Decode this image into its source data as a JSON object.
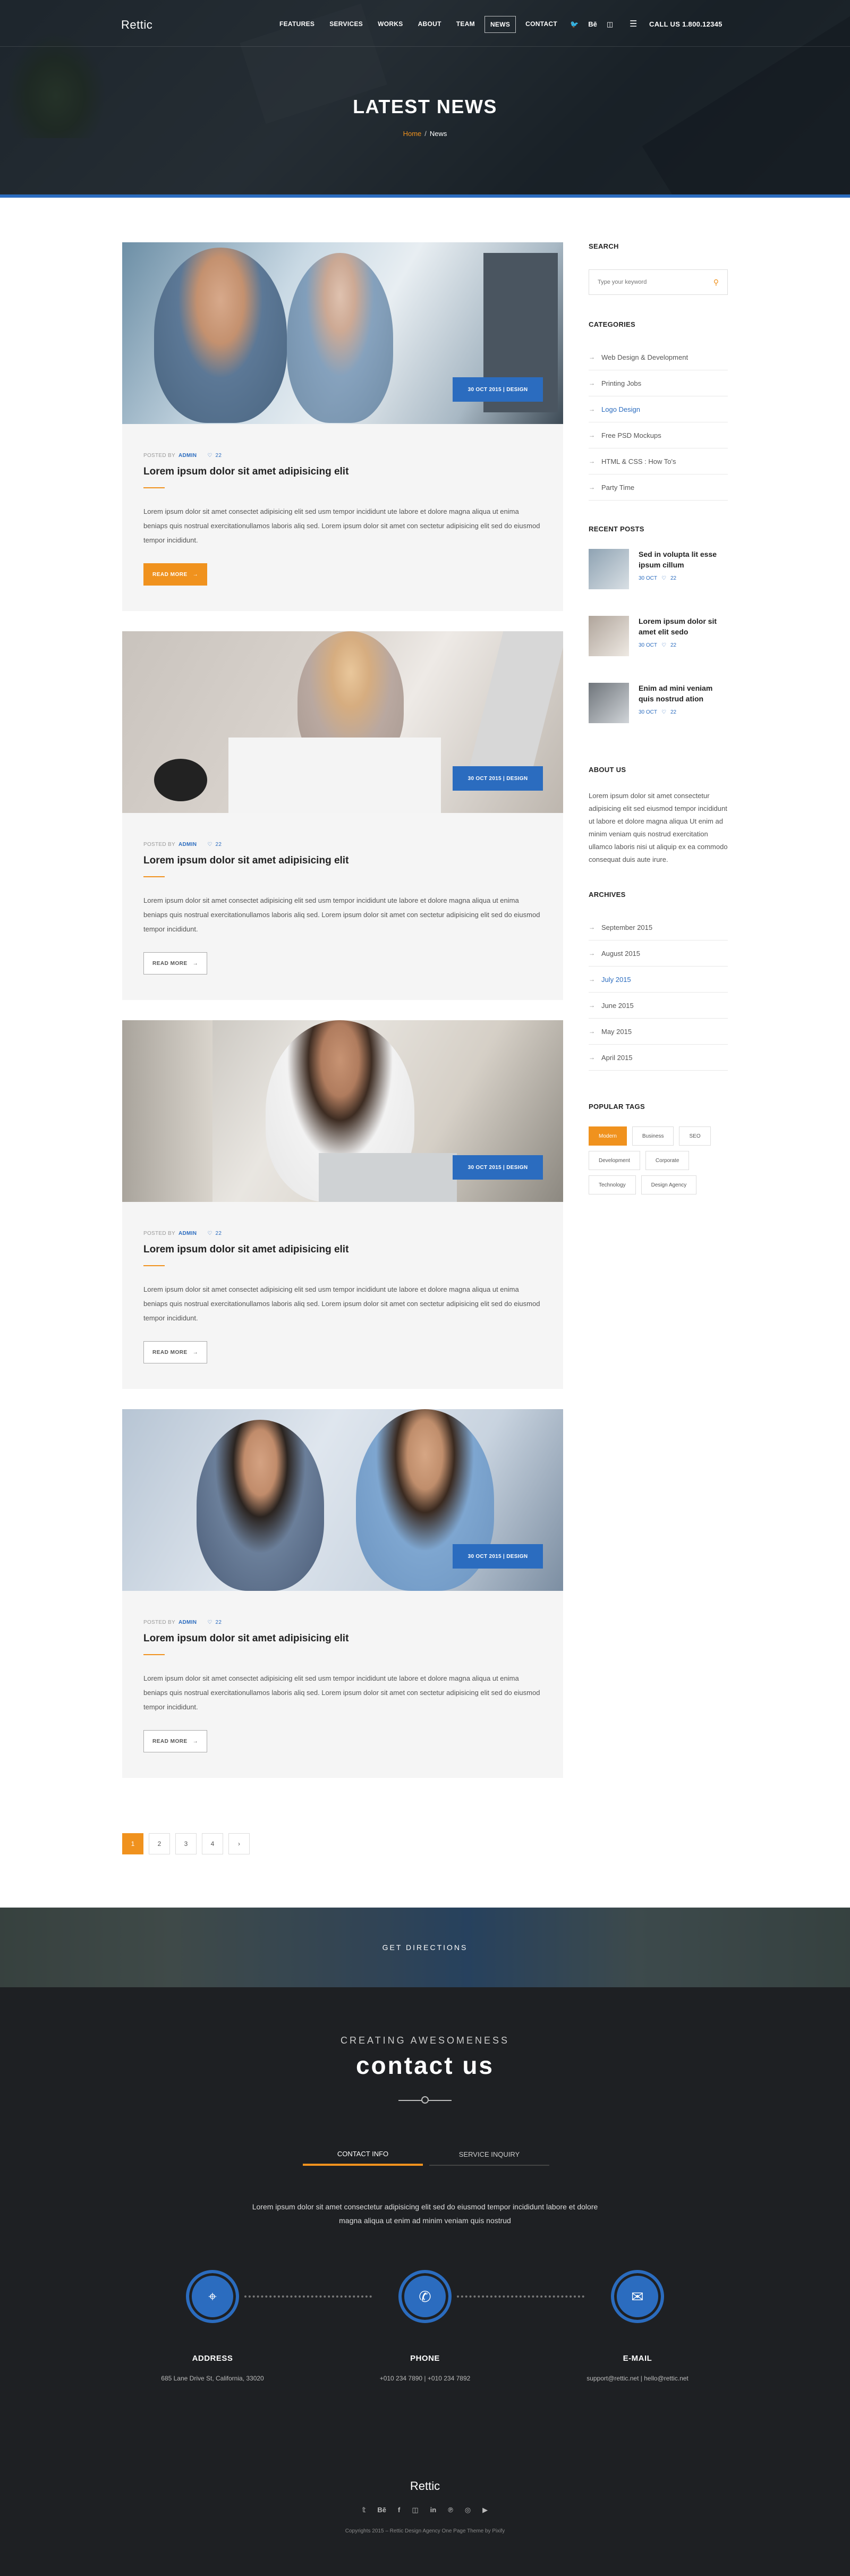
{
  "header": {
    "logo": "Rettic",
    "nav": [
      "FEATURES",
      "SERVICES",
      "WORKS",
      "ABOUT",
      "TEAM",
      "NEWS",
      "CONTACT"
    ],
    "active_nav": "NEWS",
    "social": [
      "twitter-icon",
      "behance-icon",
      "instagram-icon"
    ],
    "social_text": [
      "🐦",
      "Bē",
      "◫"
    ],
    "menu_icon": "☰",
    "call": "CALL US 1.800.12345"
  },
  "hero": {
    "title": "LATEST NEWS",
    "breadcrumb_home": "Home",
    "breadcrumb_sep": "/",
    "breadcrumb_current": "News"
  },
  "posts": [
    {
      "date_badge": "30 OCT 2015 | DESIGN",
      "posted_by": "POSTED BY",
      "author": "ADMIN",
      "comments": "22",
      "title": "Lorem ipsum dolor sit amet adipisicing elit",
      "excerpt": "Lorem ipsum dolor sit amet consectet adipisicing elit sed usm tempor incididunt ute labore et dolore magna aliqua ut enima beniaps quis nostrual exercitationullamos laboris aliq sed. Lorem ipsum dolor sit amet con sectetur adipisicing elit sed do eiusmod tempor incididunt.",
      "readmore": "READ MORE"
    },
    {
      "date_badge": "30 OCT 2015 | DESIGN",
      "posted_by": "POSTED BY",
      "author": "ADMIN",
      "comments": "22",
      "title": "Lorem ipsum dolor sit amet adipisicing elit",
      "excerpt": "Lorem ipsum dolor sit amet consectet adipisicing elit sed usm tempor incididunt ute labore et dolore magna aliqua ut enima beniaps quis nostrual exercitationullamos laboris aliq sed. Lorem ipsum dolor sit amet con sectetur adipisicing elit sed do eiusmod tempor incididunt.",
      "readmore": "READ MORE"
    },
    {
      "date_badge": "30 OCT 2015 | DESIGN",
      "posted_by": "POSTED BY",
      "author": "ADMIN",
      "comments": "22",
      "title": "Lorem ipsum dolor sit amet adipisicing elit",
      "excerpt": "Lorem ipsum dolor sit amet consectet adipisicing elit sed usm tempor incididunt ute labore et dolore magna aliqua ut enima beniaps quis nostrual exercitationullamos laboris aliq sed. Lorem ipsum dolor sit amet con sectetur adipisicing elit sed do eiusmod tempor incididunt.",
      "readmore": "READ MORE"
    },
    {
      "date_badge": "30 OCT 2015 | DESIGN",
      "posted_by": "POSTED BY",
      "author": "ADMIN",
      "comments": "22",
      "title": "Lorem ipsum dolor sit amet adipisicing elit",
      "excerpt": "Lorem ipsum dolor sit amet consectet adipisicing elit sed usm tempor incididunt ute labore et dolore magna aliqua ut enima beniaps quis nostrual exercitationullamos laboris aliq sed. Lorem ipsum dolor sit amet con sectetur adipisicing elit sed do eiusmod tempor incididunt.",
      "readmore": "READ MORE"
    }
  ],
  "pagination": [
    "1",
    "2",
    "3",
    "4",
    "›"
  ],
  "sidebar": {
    "search_title": "SEARCH",
    "search_placeholder": "Type your keyword",
    "categories_title": "CATEGORIES",
    "categories": [
      "Web Design & Development",
      "Printing Jobs",
      "Logo Design",
      "Free PSD Mockups",
      "HTML & CSS : How To's",
      "Party Time"
    ],
    "categories_active": "Logo Design",
    "recent_title": "RECENT POSTS",
    "recent": [
      {
        "title": "Sed in volupta lit esse ipsum cillum",
        "date": "30 OCT",
        "comments": "22"
      },
      {
        "title": "Lorem ipsum dolor sit amet elit sedo",
        "date": "30 OCT",
        "comments": "22"
      },
      {
        "title": "Enim ad mini veniam quis nostrud ation",
        "date": "30 OCT",
        "comments": "22"
      }
    ],
    "about_title": "ABOUT US",
    "about_text": "Lorem ipsum dolor sit amet consectetur adipisicing elit sed eiusmod tempor incididunt ut labore et dolore magna aliqua Ut enim ad minim veniam quis nostrud exercitation ullamco laboris nisi ut aliquip ex ea commodo consequat duis aute irure.",
    "archives_title": "ARCHIVES",
    "archives": [
      "September 2015",
      "August 2015",
      "July 2015",
      "June 2015",
      "May 2015",
      "April 2015"
    ],
    "archives_active": "July 2015",
    "tags_title": "POPULAR TAGS",
    "tags": [
      "Modern",
      "Business",
      "SEO",
      "Development",
      "Corporate",
      "Technology",
      "Design Agency"
    ],
    "tags_active": "Modern"
  },
  "map": {
    "label": "GET DIRECTIONS"
  },
  "contact": {
    "kicker": "CREATING AWESOMENESS",
    "title": "contact us",
    "tabs": [
      "CONTACT INFO",
      "SERVICE INQUIRY"
    ],
    "text": "Lorem ipsum dolor sit amet consectetur adipisicing elit sed do eiusmod tempor incididunt labore et dolore magna aliqua ut enim ad minim veniam quis nostrud",
    "items": [
      {
        "label": "ADDRESS",
        "value": "685 Lane Drive St, California, 33020",
        "icon": "location-pin-icon",
        "glyph": "⌖"
      },
      {
        "label": "PHONE",
        "value": "+010 234 7890  |  +010 234 7892",
        "icon": "phone-icon",
        "glyph": "✆"
      },
      {
        "label": "E-MAIL",
        "value": "support@rettic.net  |  hello@rettic.net",
        "icon": "envelope-icon",
        "glyph": "✉"
      }
    ]
  },
  "footer": {
    "logo": "Rettic",
    "social": [
      "twitter-icon",
      "behance-icon",
      "facebook-icon",
      "instagram-icon",
      "linkedin-icon",
      "pinterest-icon",
      "dribbble-icon",
      "youtube-icon"
    ],
    "social_text": [
      "𝕥",
      "Bē",
      "f",
      "◫",
      "in",
      "℗",
      "◎",
      "▶"
    ],
    "copyright": "Copyrights 2015 – Rettic Design Agency One Page Theme by Pixify"
  },
  "colors": {
    "accent": "#f0921e",
    "primary": "#2b6cbf",
    "dark": "#1e2023"
  }
}
